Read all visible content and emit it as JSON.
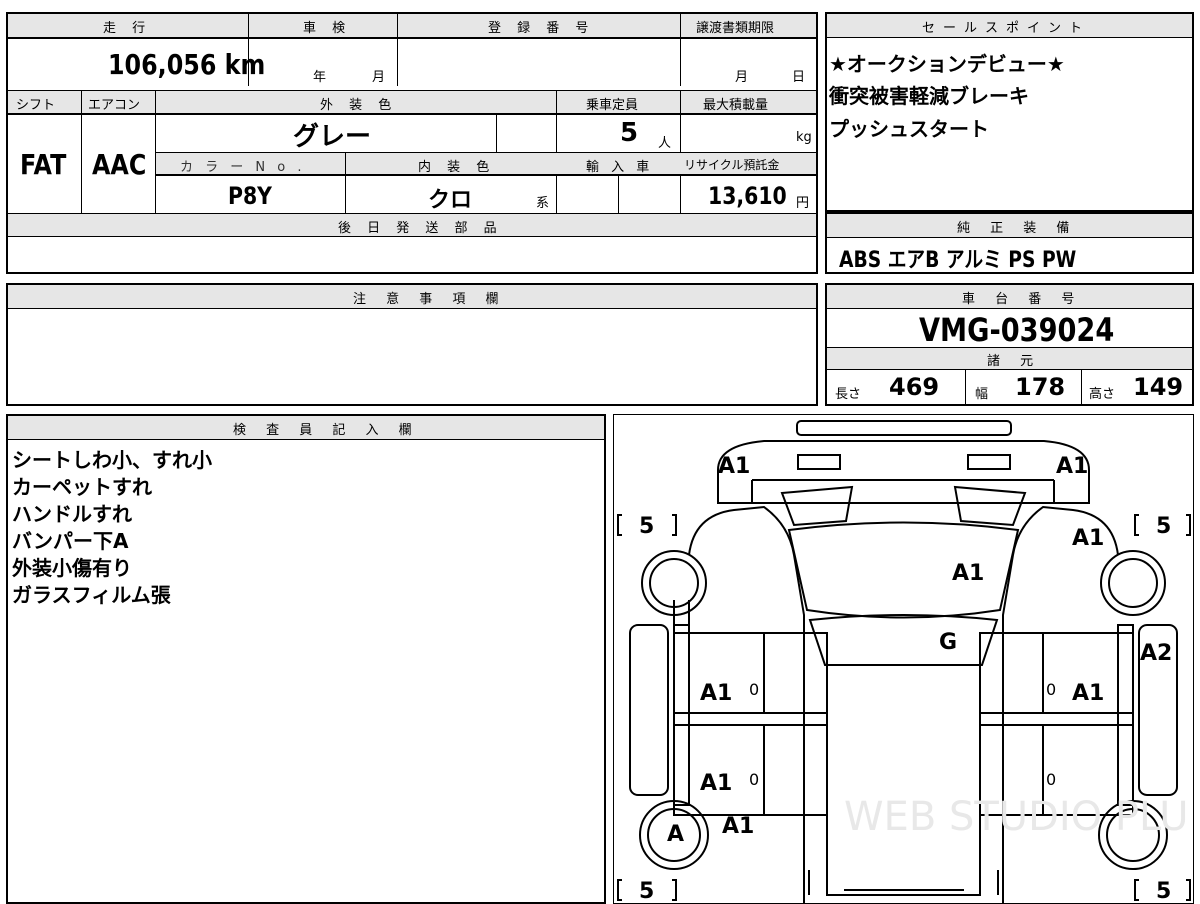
{
  "top_left": {
    "mileage_header": "走 行",
    "inspection_header": "車 検",
    "registration_header": "登 録 番 号",
    "transfer_header": "譲渡書類期限",
    "mileage_value": "106,056 km",
    "inspection_year": "年",
    "inspection_month": "月",
    "transfer_month": "月",
    "transfer_day": "日",
    "shift_header": "シフト",
    "aircon_header": "エアコン",
    "exterior_header": "外 装 色",
    "capacity_header": "乗車定員",
    "maxload_header": "最大積載量",
    "shift_value": "FAT",
    "aircon_value": "AAC",
    "exterior_value": "グレー",
    "capacity_value": "5",
    "capacity_unit": "人",
    "maxload_unit": "kg",
    "color_no_header": "カ ラ ー N o .",
    "interior_header": "内 装 色",
    "import_header": "輸 入 車",
    "recycle_header": "リサイクル預託金",
    "color_no_value": "P8Y",
    "interior_value": "クロ",
    "interior_suffix": "系",
    "recycle_value": "13,610",
    "recycle_unit": "円",
    "later_parts_header": "後 日 発 送 部 品"
  },
  "sales": {
    "header": "セールスポイント",
    "lines": [
      "★オークションデビュー★",
      "衝突被害軽減ブレーキ",
      "プッシュスタート"
    ]
  },
  "equipment": {
    "header": "純 正 装 備",
    "value": "ABS エアB アルミ PS PW"
  },
  "notes": {
    "header": "注 意 事 項 欄"
  },
  "chassis": {
    "header": "車 台 番 号",
    "value": "VMG-039024",
    "spec_header": "諸 元",
    "length_label": "長さ",
    "length_value": "469",
    "width_label": "幅",
    "width_value": "178",
    "height_label": "高さ",
    "height_value": "149"
  },
  "inspector": {
    "header": "検 査 員 記 入 欄",
    "lines": [
      "シートしわ小、すれ小",
      "カーペットすれ",
      "ハンドルすれ",
      "バンパー下A",
      "外装小傷有り",
      "ガラスフィルム張"
    ]
  },
  "diagram": {
    "marks": {
      "front_left": "A1",
      "front_right": "A1",
      "hood": "A1",
      "windshield": "G",
      "right_front_fender": "A1",
      "right_side": "A2",
      "left_front_door": "A1",
      "left_rear_door": "A1",
      "right_front_door": "A1",
      "left_rear_wheel": "A",
      "left_rear_fender": "A1",
      "door_zero_1": "0",
      "door_zero_2": "0",
      "door_zero_3": "0",
      "door_zero_4": "0"
    },
    "tires": {
      "front_left": "5",
      "front_right": "5",
      "rear_left": "5",
      "rear_right": "5"
    },
    "watermark": "WEB STUDIO PLU"
  }
}
